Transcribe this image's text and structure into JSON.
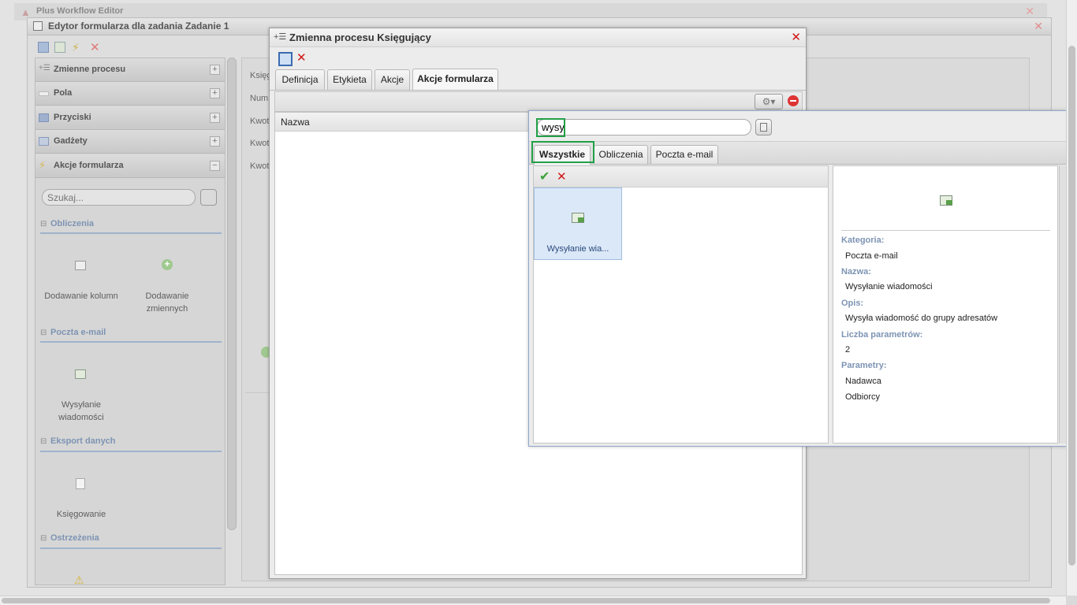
{
  "app": {
    "title": "Plus Workflow Editor",
    "editor_title": "Edytor formularza dla zadania Zadanie 1"
  },
  "left_panel": {
    "sections": [
      {
        "label": "Zmienne procesu",
        "toggle": "+"
      },
      {
        "label": "Pola",
        "toggle": "+"
      },
      {
        "label": "Przyciski",
        "toggle": "+"
      },
      {
        "label": "Gadżety",
        "toggle": "+"
      },
      {
        "label": "Akcje formularza",
        "toggle": "−"
      }
    ],
    "search_placeholder": "Szukaj...",
    "categories": [
      {
        "label": "Obliczenia"
      },
      {
        "label": "Poczta e-mail"
      },
      {
        "label": "Eksport danych"
      },
      {
        "label": "Ostrzeżenia"
      }
    ],
    "items": {
      "add_columns": "Dodawanie kolumn",
      "add_vars_1": "Dodawanie",
      "add_vars_2": "zmiennych",
      "send_msg_1": "Wysyłanie",
      "send_msg_2": "wiadomości",
      "posting": "Księgowanie"
    }
  },
  "middle_panel": {
    "labels": [
      "Księg",
      "Num",
      "Kwot",
      "Kwot",
      "Kwot"
    ]
  },
  "dialog": {
    "title": "Zmienna procesu Księgujący",
    "tabs": [
      "Definicja",
      "Etykieta",
      "Akcje",
      "Akcje formularza"
    ],
    "active_tab": "Akcje formularza",
    "grid_header": "Nazwa"
  },
  "popup": {
    "search_value": "wysy",
    "tabs": [
      "Wszystkie",
      "Obliczenia",
      "Poczta e-mail"
    ],
    "active_tab": "Wszystkie",
    "result_label": "Wysyłanie wia...",
    "details": {
      "category_label": "Kategoria:",
      "category_value": "Poczta e-mail",
      "name_label": "Nazwa:",
      "name_value": "Wysyłanie wiadomości",
      "desc_label": "Opis:",
      "desc_value": "Wysyła wiadomość do grupy adresatów",
      "param_count_label": "Liczba parametrów:",
      "param_count_value": "2",
      "params_label": "Parametry:",
      "params": [
        "Nadawca",
        "Odbiorcy"
      ]
    }
  },
  "colors": {
    "highlight": "#22a046",
    "category_blue": "#7d94b3",
    "close_red": "#d01616"
  },
  "icons": [
    "save-icon",
    "close-icon",
    "search-clear-icon",
    "settings-gear-icon",
    "remove-icon",
    "check-icon",
    "email-send-icon",
    "plus-circle-icon",
    "add-column-icon",
    "warning-icon",
    "export-icon"
  ]
}
